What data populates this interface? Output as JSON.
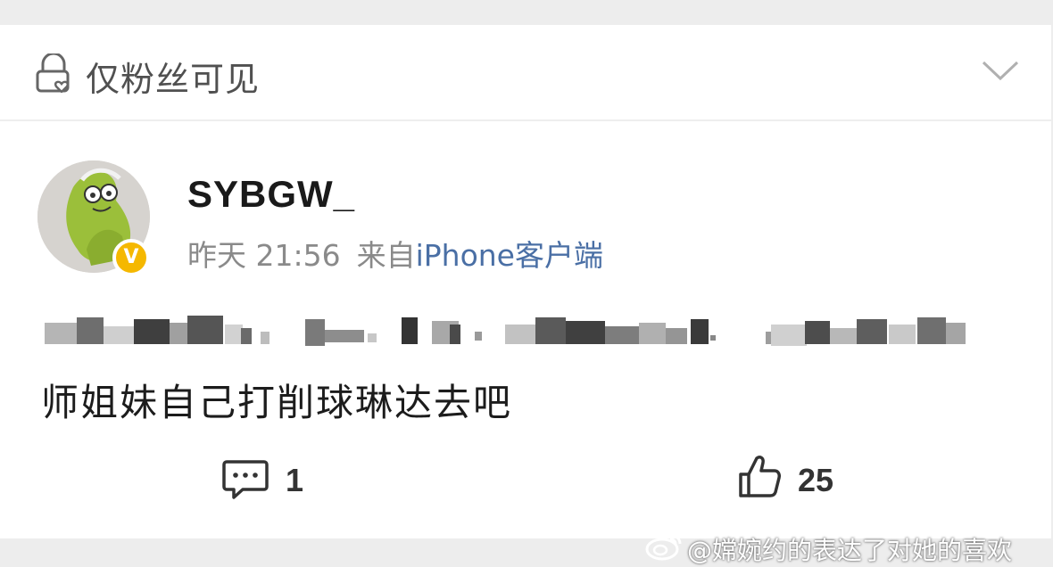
{
  "visibility": {
    "icon": "lock-heart-icon",
    "label": "仅粉丝可见",
    "dropdown_icon": "chevron-down-icon"
  },
  "post": {
    "author": "SYBGW_",
    "verified_badge": "V",
    "time": "昨天 21:56",
    "source_prefix": "来自",
    "client": "iPhone客户端",
    "text": "师姐妹自己打削球琳达去吧"
  },
  "actions": {
    "comment_icon": "comment-bubble-icon",
    "comment_count": "1",
    "like_icon": "thumbs-up-icon",
    "like_count": "25"
  },
  "watermark": {
    "text": "@嫦婉约的表达了对她的喜欢",
    "logo": "weibo-logo"
  },
  "colors": {
    "background": "#ededed",
    "card": "#ffffff",
    "client_link": "#4a6fa5",
    "verified_badge": "#f5b800",
    "secondary_text": "#8a8a8a"
  }
}
